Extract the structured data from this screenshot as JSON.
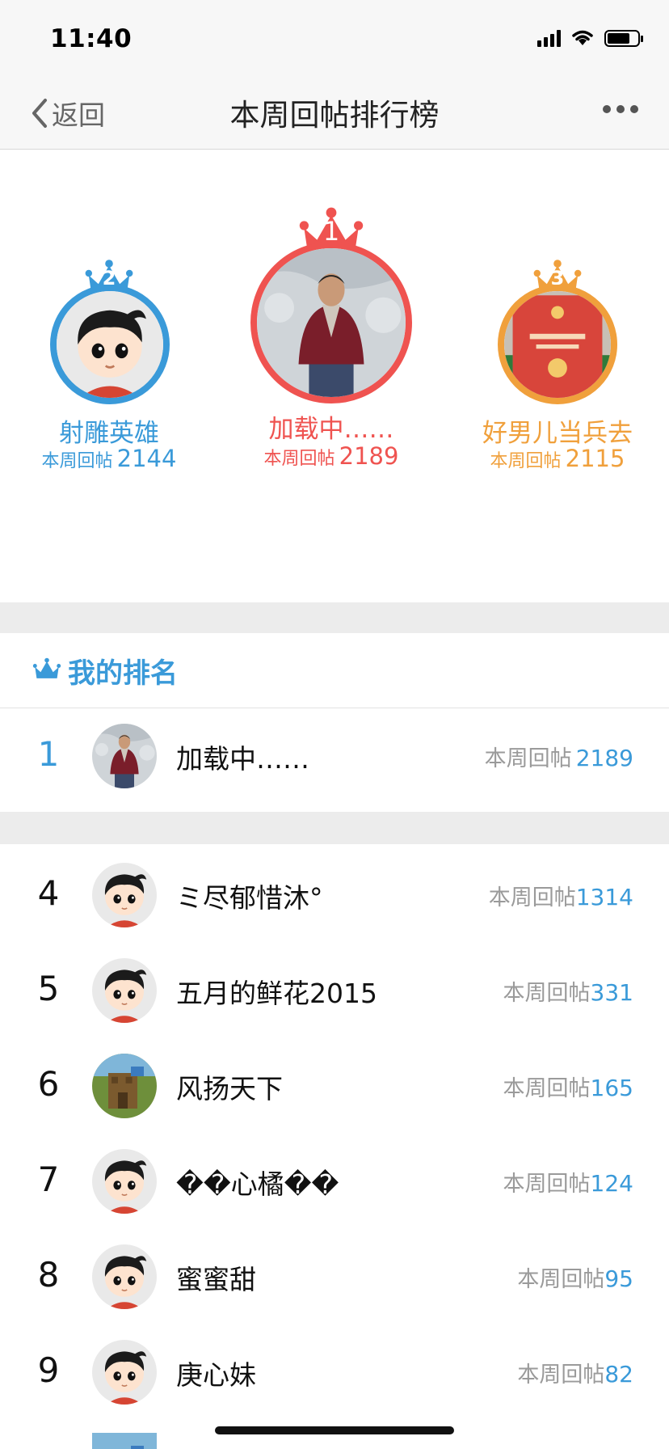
{
  "status_bar": {
    "time": "11:40"
  },
  "nav": {
    "back_label": "返回",
    "title": "本周回帖排行榜"
  },
  "podium": {
    "first": {
      "rank": "1",
      "name": "加载中……",
      "label": "本周回帖",
      "count": "2189",
      "color": "#ef5350"
    },
    "second": {
      "rank": "2",
      "name": "射雕英雄",
      "label": "本周回帖",
      "count": "2144",
      "color": "#3a9ad9"
    },
    "third": {
      "rank": "3",
      "name": "好男儿当兵去",
      "label": "本周回帖",
      "count": "2115",
      "color": "#f0a03c"
    }
  },
  "my_ranking": {
    "title": "我的排名",
    "rank": "1",
    "name": "加载中……",
    "label": "本周回帖",
    "count": "2189"
  },
  "list": [
    {
      "rank": "4",
      "name": "ミ尽郁惜沐°",
      "label": "本周回帖",
      "count": "1314"
    },
    {
      "rank": "5",
      "name": "五月的鲜花2015",
      "label": "本周回帖",
      "count": "331"
    },
    {
      "rank": "6",
      "name": "风扬天下",
      "label": "本周回帖",
      "count": "165"
    },
    {
      "rank": "7",
      "name": "��心橘��",
      "label": "本周回帖",
      "count": "124"
    },
    {
      "rank": "8",
      "name": "蜜蜜甜",
      "label": "本周回帖",
      "count": "95"
    },
    {
      "rank": "9",
      "name": "庚心妹",
      "label": "本周回帖",
      "count": "82"
    }
  ],
  "colors": {
    "accent_blue": "#3a9ad9",
    "first_red": "#ef5350",
    "third_orange": "#f0a03c"
  }
}
